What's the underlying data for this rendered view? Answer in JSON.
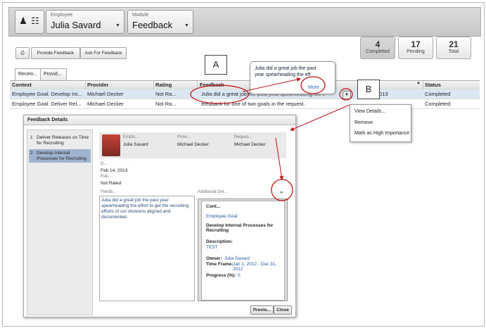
{
  "header": {
    "employee_label": "Employee",
    "employee_value": "Julia Savard",
    "module_label": "Module",
    "module_value": "Feedback"
  },
  "stats": [
    {
      "count": "4",
      "label": "Completed"
    },
    {
      "count": "17",
      "label": "Pending"
    },
    {
      "count": "21",
      "label": "Total"
    }
  ],
  "toolbar": {
    "provide_feedback": "Provide Feedback",
    "ask_for_feedback": "Ask For Feedback"
  },
  "tabs": [
    "Receiv...",
    "Provid..."
  ],
  "grid": {
    "columns": [
      "Context",
      "Provider",
      "Rating",
      "Feedback",
      "Status"
    ],
    "rows": [
      {
        "context": "Employee Goal: Develop Int...",
        "provider": "Michael Decker",
        "rating": "Not Ra...",
        "feedback": "Julia did a great job the past year spearheading the e",
        "date": "013",
        "status": "Completed"
      },
      {
        "context": "Employee Goal: Deliver Rel...",
        "provider": "Michael Decker",
        "rating": "Not Ra...",
        "feedback": "feedback for one of two goals in the request.",
        "status": "Completed"
      }
    ]
  },
  "tooltip": {
    "text": "Julia did a great job the past year spearheading the eff",
    "more": "More"
  },
  "callouts": {
    "a": "A",
    "b": "B"
  },
  "context_menu": [
    "View Details...",
    "Remove",
    "Mark as High Importance"
  ],
  "dialog": {
    "title": "Feedback Details",
    "list": [
      {
        "num": "1",
        "text": "Deliver Releases on Time for Recruiting"
      },
      {
        "num": "2",
        "text": "Develop Internal Processes for Recruiting"
      }
    ],
    "employee_label": "Emplo...",
    "employee_value": "Julia Savard",
    "provider_label": "Provi...",
    "provider_value": "Michael Decker",
    "requester_label": "Reques...",
    "requester_value": "Michael Decker",
    "date_label": "D...",
    "date_value": "Feb 14, 2013",
    "rating_label": "Rati...",
    "rating_value": "Not Rated",
    "feedback_label": "Feedb...",
    "feedback_text": "Julia did a great job the past year spearheading the effort to get the recruiting efforts of our divisions aligned and documented.",
    "additional_label": "Additional Det...",
    "expand": "››",
    "panel": {
      "title": "Cont...",
      "type": "Employee Goal",
      "goal": "Develop Internal Processes for Recruiting",
      "description_label": "Description:",
      "description_value": "TEST",
      "owner_label": "Owner:",
      "owner_value": "Julia Savard",
      "timeframe_label": "Time Frame:",
      "timeframe_value": "Jan 1, 2012 - Dec 31, 2012",
      "progress_label": "Progress (%):",
      "progress_value": "0"
    },
    "prev_button": "Previo...",
    "close_button": "Close"
  },
  "colors": {
    "accent_red": "#c0161a",
    "link_blue": "#2a6fc4",
    "selected_row": "#dbe8f4"
  }
}
